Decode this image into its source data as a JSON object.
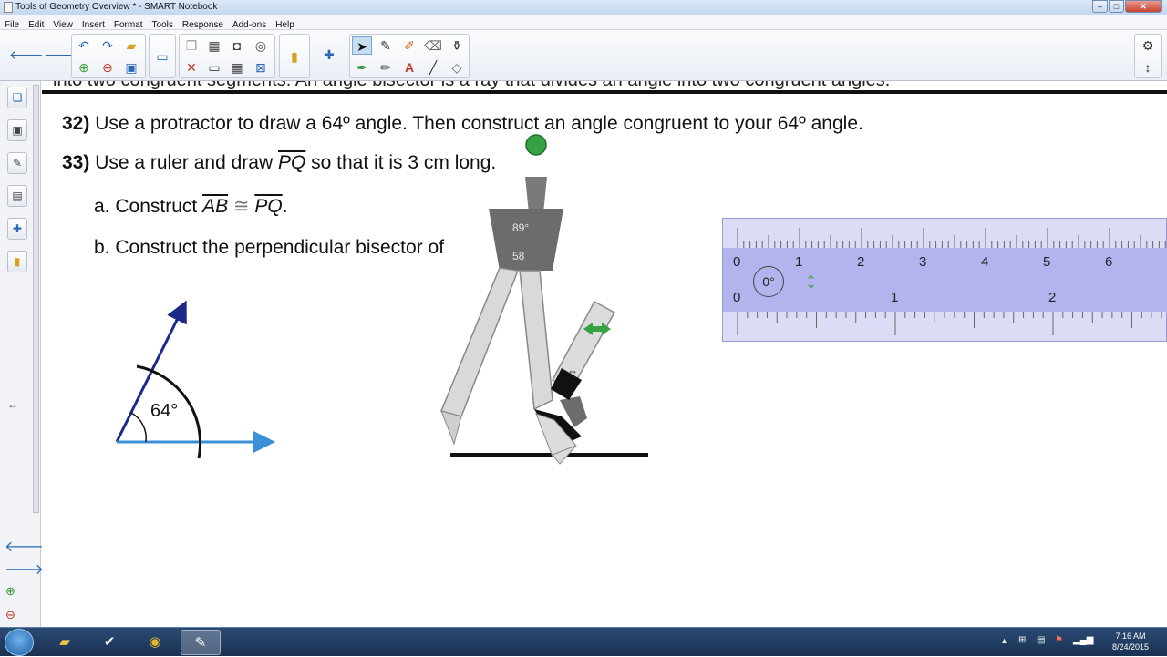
{
  "window": {
    "title": "Tools of Geometry Overview * - SMART Notebook",
    "minimize": "‒",
    "maximize": "□",
    "close": "✕"
  },
  "menu": [
    "File",
    "Edit",
    "View",
    "Insert",
    "Format",
    "Tools",
    "Response",
    "Add-ons",
    "Help"
  ],
  "toolbar": {
    "back_icon": "arrow-left-icon",
    "forward_icon": "arrow-right-icon"
  },
  "page": {
    "cut_text": "into two congruent segments. An angle bisector is a ray that divides an angle into two congruent angles.",
    "q32_num": "32)",
    "q32_text": " Use a protractor to draw a 64º angle. Then construct an angle congruent to your 64º angle.",
    "q33_num": "33)",
    "q33_pre": " Use a ruler and draw ",
    "q33_seg": "PQ",
    "q33_post": " so that it is 3 cm long.",
    "qa_pre": "a. Construct ",
    "qa_seg1": "AB",
    "qa_cong": " ≅ ",
    "qa_seg2": "PQ",
    "qa_post": ".",
    "qb_text": "b. Construct the perpendicular bisector of",
    "angle_label": "64°"
  },
  "compass": {
    "angle_readout": "89°",
    "radius_readout": "58"
  },
  "ruler": {
    "rotation_label": "0°",
    "cm_labels": [
      "0",
      "1",
      "2",
      "3",
      "4",
      "5",
      "6"
    ],
    "in_labels": [
      "0",
      "1",
      "2"
    ]
  },
  "taskbar": {
    "time": "7:16 AM",
    "date": "8/24/2015"
  },
  "colors": {
    "ray_dark": "#1b2a8a",
    "ray_light": "#3a8fd6",
    "ruler_band": "#b3b3ee",
    "ruler_bg": "#d8d8f6",
    "compass_grip": "#6c6c6c",
    "green_handle": "#36a244"
  }
}
